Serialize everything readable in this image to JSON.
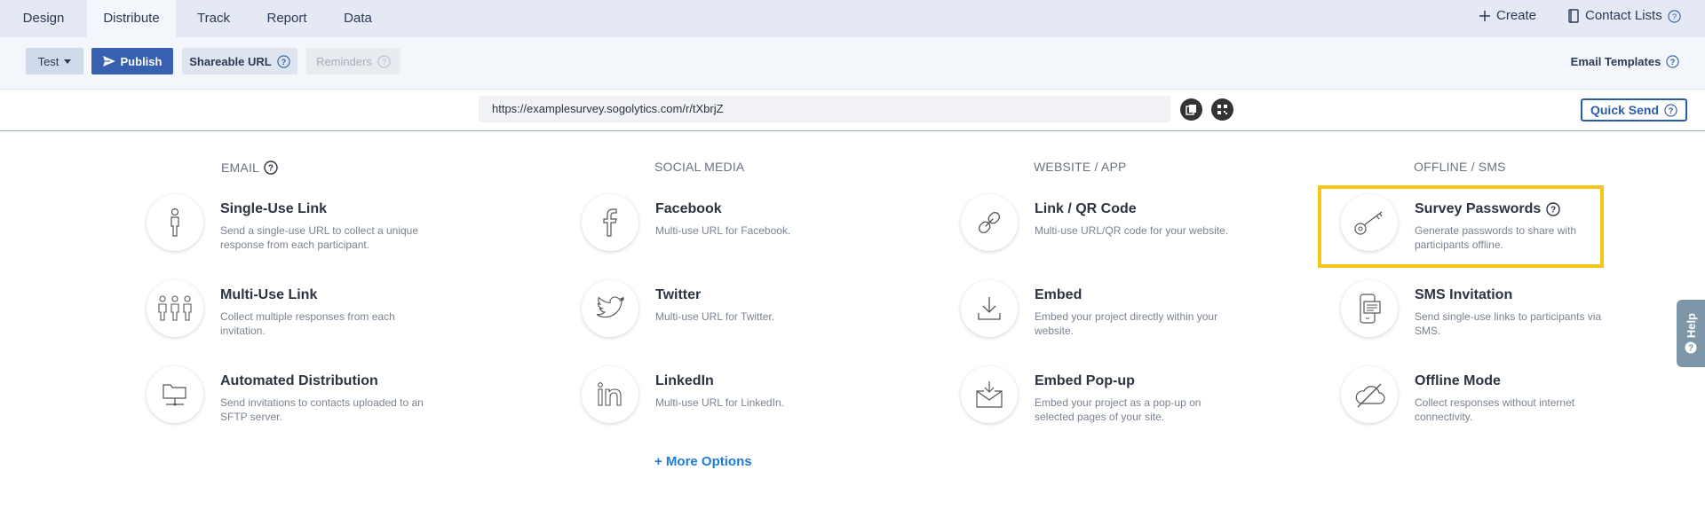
{
  "nav": {
    "tabs": [
      "Design",
      "Distribute",
      "Track",
      "Report",
      "Data"
    ],
    "create_label": "Create",
    "contact_lists_label": "Contact Lists"
  },
  "toolbar": {
    "test_label": "Test",
    "publish_label": "Publish",
    "shareable_url_label": "Shareable URL",
    "reminders_label": "Reminders",
    "email_templates_label": "Email Templates"
  },
  "urlbar": {
    "url": "https://examplesurvey.sogolytics.com/r/tXbrjZ",
    "quick_send_label": "Quick Send"
  },
  "columns": {
    "email": {
      "heading": "EMAIL",
      "items": [
        {
          "title": "Single-Use Link",
          "desc": "Send a single-use URL to collect a unique response from each participant."
        },
        {
          "title": "Multi-Use Link",
          "desc": "Collect multiple responses from each invitation."
        },
        {
          "title": "Automated Distribution",
          "desc": "Send invitations to contacts uploaded to an SFTP server."
        }
      ]
    },
    "social": {
      "heading": "SOCIAL MEDIA",
      "items": [
        {
          "title": "Facebook",
          "desc": "Multi-use URL for Facebook."
        },
        {
          "title": "Twitter",
          "desc": "Multi-use URL for Twitter."
        },
        {
          "title": "LinkedIn",
          "desc": "Multi-use URL for LinkedIn."
        }
      ]
    },
    "website": {
      "heading": "WEBSITE / APP",
      "items": [
        {
          "title": "Link / QR Code",
          "desc": "Multi-use URL/QR code for your website."
        },
        {
          "title": "Embed",
          "desc": "Embed your project directly within your website."
        },
        {
          "title": "Embed Pop-up",
          "desc": "Embed your project as a pop-up on selected pages of your site."
        }
      ]
    },
    "offline": {
      "heading": "OFFLINE / SMS",
      "items": [
        {
          "title": "Survey Passwords",
          "desc": "Generate passwords to share with participants offline."
        },
        {
          "title": "SMS Invitation",
          "desc": "Send single-use links to participants via SMS."
        },
        {
          "title": "Offline Mode",
          "desc": "Collect responses without internet connectivity."
        }
      ]
    }
  },
  "more_options_label": "+ More Options",
  "help_tab_label": "Help",
  "colors": {
    "accent": "#2b5ea7",
    "highlight": "#f5c518",
    "link": "#1e7ad8"
  }
}
